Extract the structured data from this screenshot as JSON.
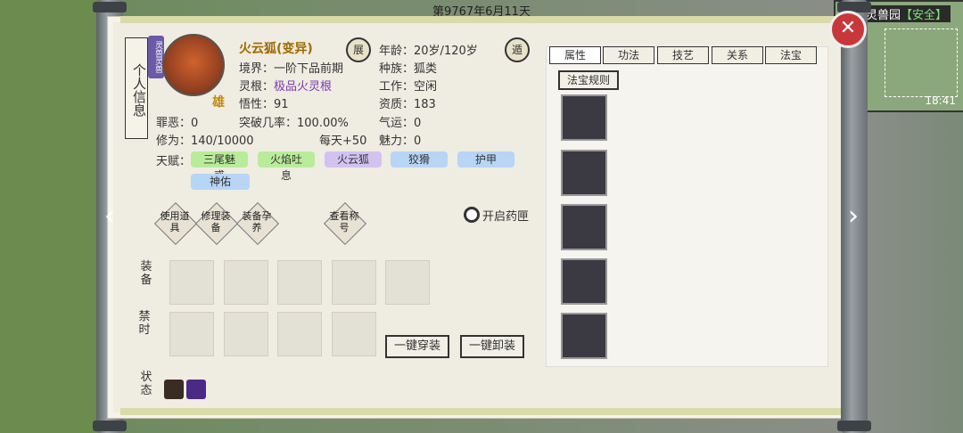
{
  "date": "第9767年6月11天",
  "minimap": {
    "title": "灵兽园",
    "safe": "【安全】",
    "time": "18:41"
  },
  "side_tag": "个人信息",
  "type_tag": "灵兽灵兽",
  "gender": "雄",
  "name": "火云狐(变异)",
  "btn_expand": "展",
  "btn_escape": "遁",
  "info": {
    "realm_label": "境界：",
    "realm": "一阶下品前期",
    "root_label": "灵根：",
    "root": "极品火灵根",
    "wu_label": "悟性：",
    "wu": "91",
    "sin_label": "罪恶：",
    "sin": "0",
    "breakthrough_label": "突破几率：",
    "breakthrough": "100.00%",
    "cultivation_label": "修为：",
    "cultivation": "140/10000",
    "daily_label": "每天+",
    "daily": "50",
    "age_label": "年龄：",
    "age": "20岁/120岁",
    "race_label": "种族：",
    "race": "狐类",
    "work_label": "工作：",
    "work": "空闲",
    "aptitude_label": "资质：",
    "aptitude": "183",
    "luck_label": "气运：",
    "luck": "0",
    "charm_label": "魅力：",
    "charm": "0"
  },
  "talent_label": "天赋：",
  "talents": [
    "三尾魅惑",
    "火焰吐息",
    "火云狐",
    "狡猾",
    "护甲",
    "神佑"
  ],
  "actions": [
    "使用道具",
    "修理装备",
    "装备孕养",
    "查看称号"
  ],
  "medicine": "开启药匣",
  "labels": {
    "equip": "装备",
    "forbid": "禁时",
    "status": "状态"
  },
  "buttons": {
    "equip_all": "一键穿装",
    "unequip_all": "一键卸装"
  },
  "tabs": [
    "属性",
    "功法",
    "技艺",
    "关系",
    "法宝"
  ],
  "fabao_rule": "法宝规则",
  "colors": {
    "accent": "#a06a00",
    "purple": "#7c3ab0",
    "talent_green": "#b9ec9a",
    "talent_purple": "#d3c2f1",
    "talent_blue": "#b7d5f5"
  }
}
